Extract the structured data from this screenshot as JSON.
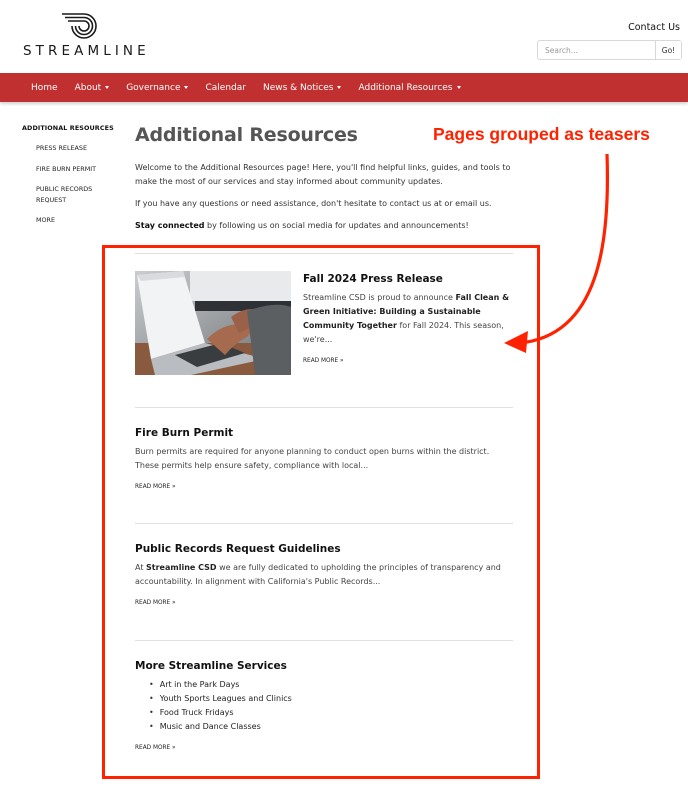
{
  "header": {
    "logo_text": "STREAMLINE",
    "logo_icon": "streamline-swoosh-icon",
    "contact_label": "Contact Us",
    "search": {
      "placeholder": "Search...",
      "value": "",
      "button_label": "Go!"
    }
  },
  "nav": {
    "background": "#c03030",
    "items": [
      {
        "label": "Home",
        "dropdown": false
      },
      {
        "label": "About",
        "dropdown": true
      },
      {
        "label": "Governance",
        "dropdown": true
      },
      {
        "label": "Calendar",
        "dropdown": false
      },
      {
        "label": "News & Notices",
        "dropdown": true
      },
      {
        "label": "Additional Resources",
        "dropdown": true
      }
    ]
  },
  "sidebar": {
    "heading": "ADDITIONAL RESOURCES",
    "items": [
      {
        "label": "PRESS RELEASE"
      },
      {
        "label": "FIRE BURN PERMIT"
      },
      {
        "label": "PUBLIC RECORDS REQUEST"
      },
      {
        "label": "MORE"
      }
    ]
  },
  "main": {
    "title": "Additional Resources",
    "intro": {
      "p1": "Welcome to the Additional Resources page! Here, you'll find helpful links, guides, and tools to make the most of our services and stay informed about community updates.",
      "p2": "If you have any questions or need assistance, don't hesitate to contact us at or email us.",
      "p3_bold": "Stay connected",
      "p3_rest": " by following us on social media for updates and announcements!"
    },
    "teasers": [
      {
        "title": "Fall 2024 Press Release",
        "body_pre": "Streamline CSD is proud to announce ",
        "body_bold": "Fall Clean & Green Initiative: Building a Sustainable Community Together",
        "body_post": " for Fall 2024. This season, we're...",
        "image": "laptop-typing-photo",
        "read_more": "READ MORE »"
      },
      {
        "title": "Fire Burn Permit",
        "body": "Burn permits are required for anyone planning to conduct open burns within the district. These permits help ensure safety, compliance with local...",
        "read_more": "READ MORE »"
      },
      {
        "title": "Public Records Request Guidelines",
        "body_pre": "At ",
        "body_bold": "Streamline CSD",
        "body_post": " we are fully dedicated to upholding the principles of transparency and accountability. In alignment with California's Public Records...",
        "read_more": "READ MORE »"
      },
      {
        "title": "More Streamline Services",
        "list": [
          "Art in the Park Days",
          "Youth Sports Leagues and Clinics",
          "Food Truck Fridays",
          "Music and Dance Classes"
        ],
        "read_more": "READ MORE »"
      }
    ]
  },
  "annotation": {
    "label": "Pages grouped as teasers",
    "color": "#ff2200"
  }
}
